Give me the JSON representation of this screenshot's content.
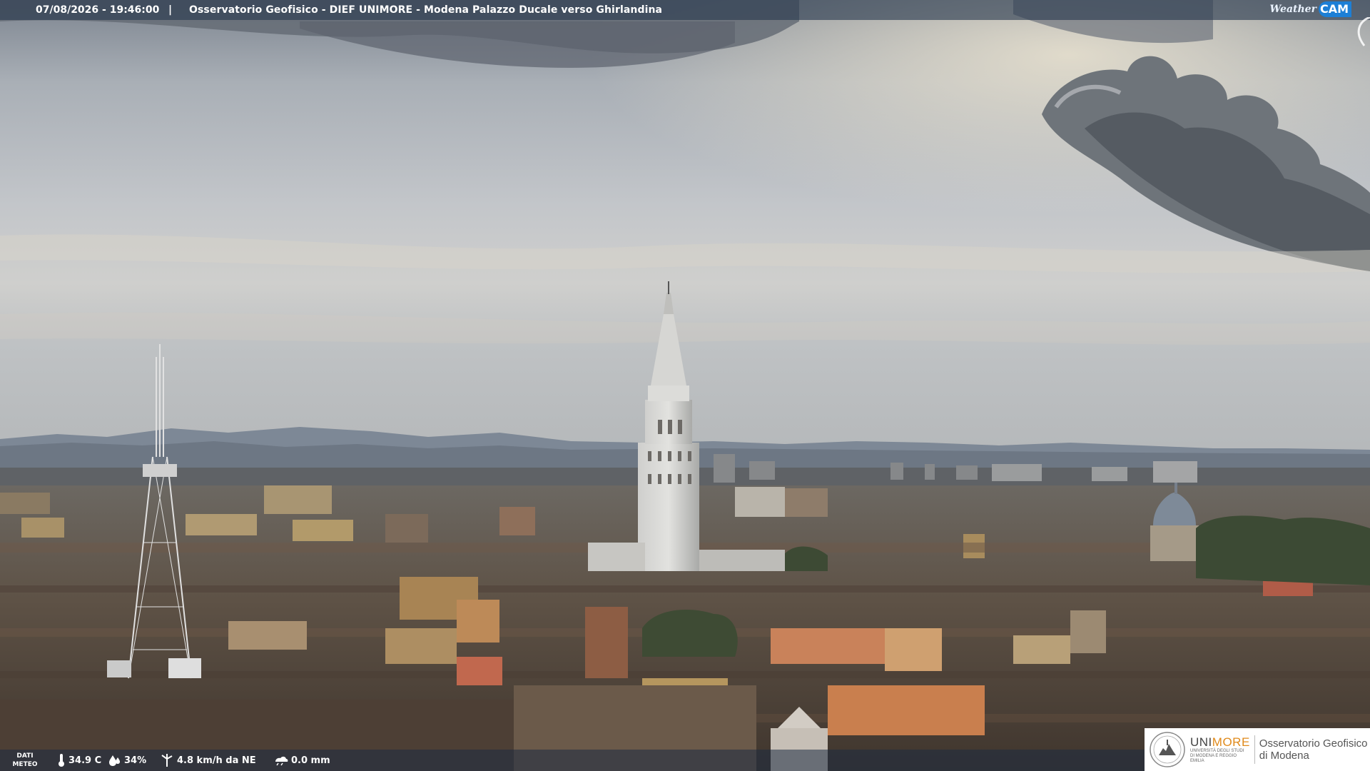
{
  "topbar": {
    "timestamp": "07/08/2026 - 19:46:00",
    "separator": "|",
    "title": "Osservatorio Geofisico - DIEF UNIMORE - Modena Palazzo Ducale verso Ghirlandina"
  },
  "weathercam_logo": {
    "word": "Weather",
    "cam": "CAM"
  },
  "meteo": {
    "label_line1": "DATI",
    "label_line2": "METEO",
    "temperature": "34.9 C",
    "humidity": "34%",
    "wind": "4.8 km/h da NE",
    "rain": "0.0 mm",
    "icons": [
      "thermometer-icon",
      "humidity-drop-icon",
      "wind-icon",
      "rain-gauge-icon"
    ]
  },
  "university_logo": {
    "name_part1": "UNI",
    "name_part2": "MORE",
    "subtitle": "UNIVERSITÀ DEGLI STUDI DI MODENA E REGGIO EMILIA",
    "observatory_line1": "Osservatorio Geofisico",
    "observatory_line2": "di Modena"
  },
  "colors": {
    "accent_orange": "#e08a1b",
    "cam_blue": "#1d7fd6",
    "bar_overlay": "#28384e"
  }
}
